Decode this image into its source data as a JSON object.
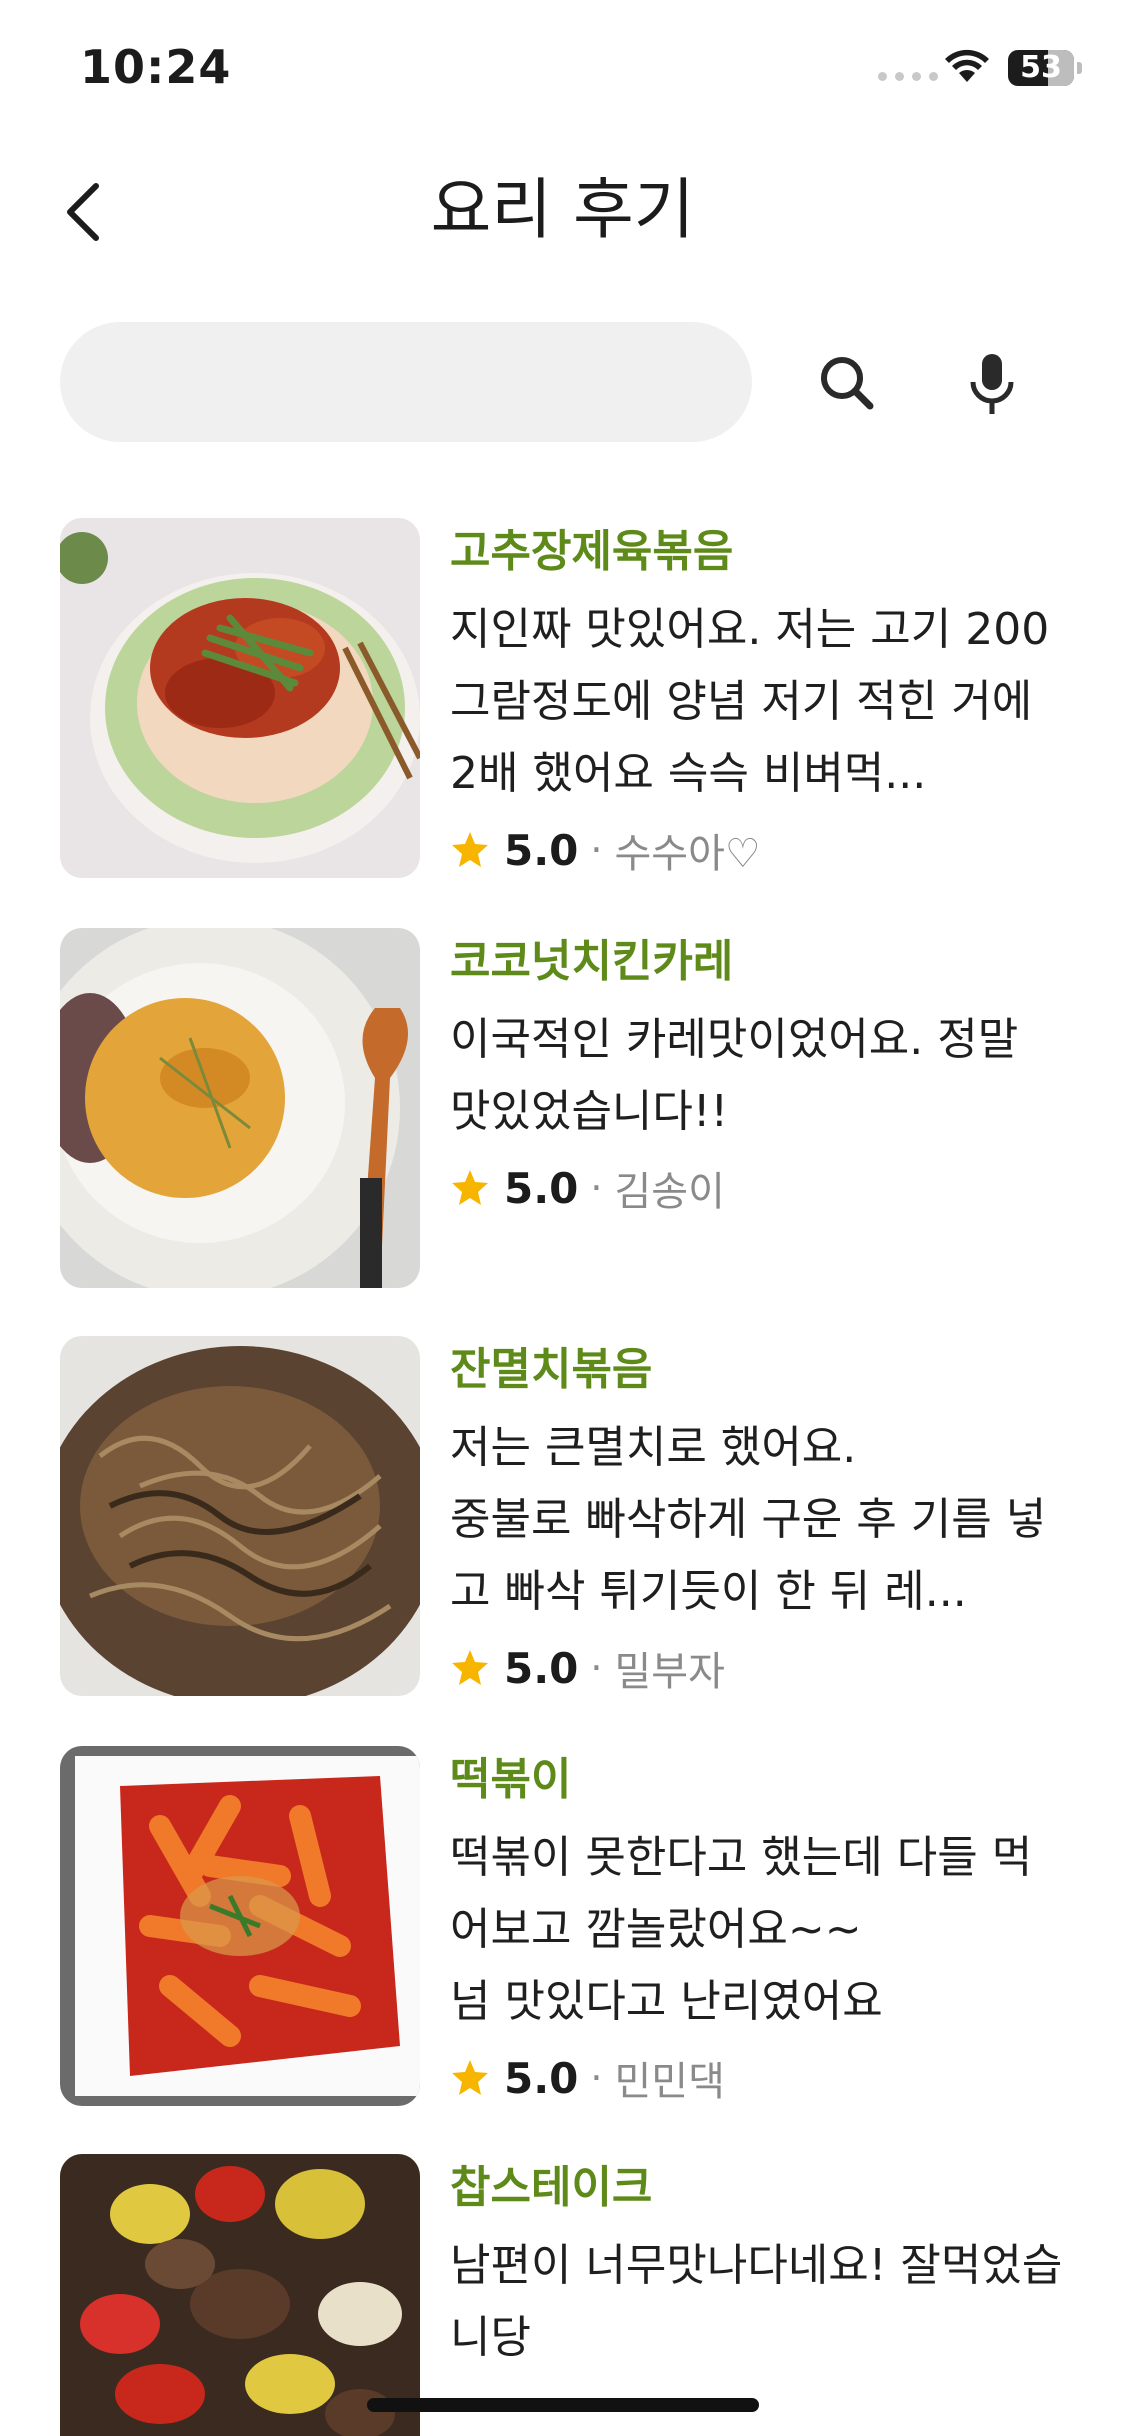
{
  "status_bar": {
    "time": "10:24",
    "battery": "53"
  },
  "header": {
    "title": "요리 후기"
  },
  "search": {
    "value": "",
    "placeholder": ""
  },
  "icons": {
    "back": "chevron-left-icon",
    "search": "search-icon",
    "mic": "microphone-icon",
    "star": "star-icon"
  },
  "colors": {
    "dish_name": "#5e8a1a",
    "star": "#f7b500",
    "search_bg": "#f0f0f0"
  },
  "reviews": [
    {
      "dish": "고추장제육볶음",
      "text": "지인짜 맛있어요. 저는 고기 200그람정도에 양념 저기 적힌 거에 2배 했어요 슥슥 비벼먹...",
      "rating": "5.0",
      "author": "수수아♡"
    },
    {
      "dish": "코코넛치킨카레",
      "text": "이국적인 카레맛이었어요. 정말 맛있었습니다!!",
      "rating": "5.0",
      "author": "김송이"
    },
    {
      "dish": "잔멸치볶음",
      "text": "저는 큰멸치로 했어요.\n중불로 빠삭하게 구운 후 기름 넣고 빠삭 튀기듯이 한 뒤 레...",
      "rating": "5.0",
      "author": "밀부자"
    },
    {
      "dish": "떡볶이",
      "text": "떡볶이 못한다고 했는데 다들 먹어보고 깜놀랐어요~~\n넘 맛있다고 난리였어요",
      "rating": "5.0",
      "author": "민민댁"
    },
    {
      "dish": "찹스테이크",
      "text": "남편이 너무맛나다네요! 잘먹었습니당",
      "rating": "",
      "author": ""
    }
  ]
}
